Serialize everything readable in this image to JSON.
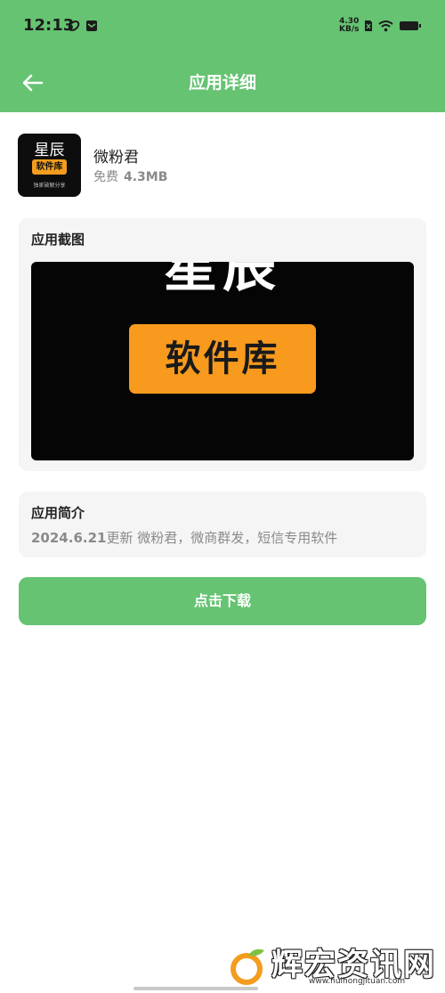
{
  "status_bar": {
    "time": "12:13",
    "net_speed_value": "4.30",
    "net_speed_unit": "KB/s",
    "icons": [
      "app-notification-icon",
      "message-icon",
      "no-sim-icon",
      "wifi-icon",
      "battery-icon"
    ]
  },
  "header": {
    "title": "应用详细",
    "back_icon": "back-arrow-icon"
  },
  "app": {
    "name": "微粉君",
    "price": "免费",
    "size": "4.3MB",
    "logo": {
      "top_text": "星辰",
      "badge_text": "软件库",
      "bottom_text": "独家破解分享"
    }
  },
  "screenshots_section": {
    "title": "应用截图",
    "image_top_text": "星辰",
    "image_badge_text": "软件库"
  },
  "intro_section": {
    "title": "应用简介",
    "date": "2024.6.21",
    "body": "更新 微粉君，微商群发，短信专用软件"
  },
  "download_button": {
    "label": "点击下载"
  },
  "watermark": {
    "text": "辉宏资讯网",
    "url": "www.huihongjituan.com"
  },
  "colors": {
    "brand_green": "#65c372",
    "badge_orange": "#f39c1f",
    "card_bg": "#f5f5f5"
  }
}
